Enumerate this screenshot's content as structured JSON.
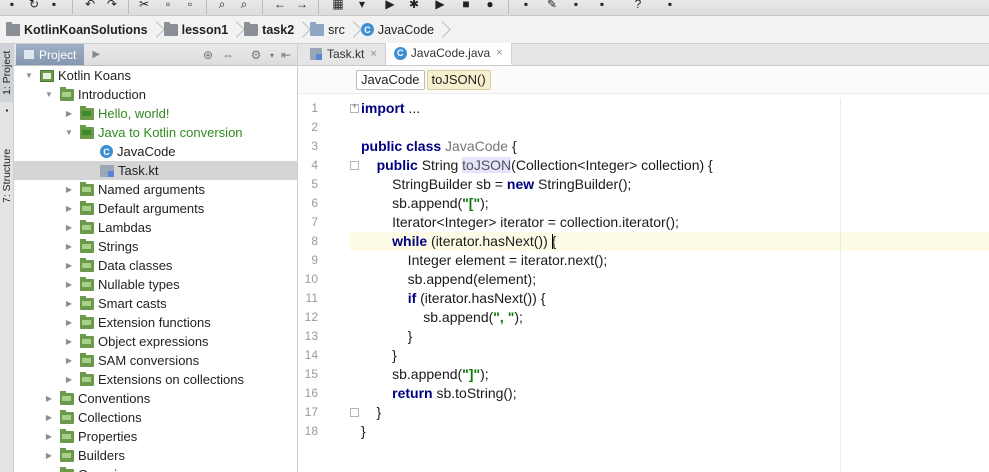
{
  "breadcrumb": {
    "items": [
      {
        "label": "KotlinKoanSolutions",
        "bold": true,
        "icon": "folder-icon"
      },
      {
        "label": "lesson1",
        "bold": true,
        "icon": "folder-icon"
      },
      {
        "label": "task2",
        "bold": true,
        "icon": "folder-icon"
      },
      {
        "label": "src",
        "bold": false,
        "icon": "source-folder-icon"
      },
      {
        "label": "JavaCode",
        "bold": false,
        "icon": "class-icon"
      }
    ]
  },
  "stripe": {
    "project_label": "1: Project",
    "structure_label": "7: Structure"
  },
  "project_panel": {
    "tab_label": "Project",
    "tree": [
      {
        "label": "Kotlin Koans",
        "depth": 0,
        "state": "open",
        "icon": "koans-icon",
        "green": false,
        "selected": false
      },
      {
        "label": "Introduction",
        "depth": 1,
        "state": "open",
        "icon": "task-icon",
        "green": false,
        "selected": false
      },
      {
        "label": "Hello, world!",
        "depth": 2,
        "state": "closed",
        "icon": "task-done-icon",
        "green": true,
        "selected": false
      },
      {
        "label": "Java to Kotlin conversion",
        "depth": 2,
        "state": "open",
        "icon": "task-done-icon",
        "green": true,
        "selected": false
      },
      {
        "label": "JavaCode",
        "depth": 3,
        "state": "none",
        "icon": "class-icon",
        "green": false,
        "selected": false
      },
      {
        "label": "Task.kt",
        "depth": 3,
        "state": "none",
        "icon": "kotlin-file-icon",
        "green": false,
        "selected": true
      },
      {
        "label": "Named arguments",
        "depth": 2,
        "state": "closed",
        "icon": "task-icon",
        "green": false,
        "selected": false
      },
      {
        "label": "Default arguments",
        "depth": 2,
        "state": "closed",
        "icon": "task-icon",
        "green": false,
        "selected": false
      },
      {
        "label": "Lambdas",
        "depth": 2,
        "state": "closed",
        "icon": "task-icon",
        "green": false,
        "selected": false
      },
      {
        "label": "Strings",
        "depth": 2,
        "state": "closed",
        "icon": "task-icon",
        "green": false,
        "selected": false
      },
      {
        "label": "Data classes",
        "depth": 2,
        "state": "closed",
        "icon": "task-icon",
        "green": false,
        "selected": false
      },
      {
        "label": "Nullable types",
        "depth": 2,
        "state": "closed",
        "icon": "task-icon",
        "green": false,
        "selected": false
      },
      {
        "label": "Smart casts",
        "depth": 2,
        "state": "closed",
        "icon": "task-icon",
        "green": false,
        "selected": false
      },
      {
        "label": "Extension functions",
        "depth": 2,
        "state": "closed",
        "icon": "task-icon",
        "green": false,
        "selected": false
      },
      {
        "label": "Object expressions",
        "depth": 2,
        "state": "closed",
        "icon": "task-icon",
        "green": false,
        "selected": false
      },
      {
        "label": "SAM conversions",
        "depth": 2,
        "state": "closed",
        "icon": "task-icon",
        "green": false,
        "selected": false
      },
      {
        "label": "Extensions on collections",
        "depth": 2,
        "state": "closed",
        "icon": "task-icon",
        "green": false,
        "selected": false
      },
      {
        "label": "Conventions",
        "depth": 1,
        "state": "closed",
        "icon": "task-icon",
        "green": false,
        "selected": false
      },
      {
        "label": "Collections",
        "depth": 1,
        "state": "closed",
        "icon": "task-icon",
        "green": false,
        "selected": false
      },
      {
        "label": "Properties",
        "depth": 1,
        "state": "closed",
        "icon": "task-icon",
        "green": false,
        "selected": false
      },
      {
        "label": "Builders",
        "depth": 1,
        "state": "closed",
        "icon": "task-icon",
        "green": false,
        "selected": false
      },
      {
        "label": "Generics",
        "depth": 1,
        "state": "closed",
        "icon": "task-icon",
        "green": false,
        "selected": false
      }
    ]
  },
  "editor": {
    "tabs": [
      {
        "label": "Task.kt",
        "active": false,
        "icon": "kotlin-file-icon"
      },
      {
        "label": "JavaCode.java",
        "active": true,
        "icon": "class-icon"
      }
    ],
    "structure_breadcrumb": [
      {
        "label": "JavaCode",
        "active": false
      },
      {
        "label": "toJSON()",
        "active": true
      }
    ],
    "caret_line": 8,
    "lines": [
      [
        [
          "kw",
          "import"
        ],
        [
          "plain",
          " ..."
        ]
      ],
      [],
      [
        [
          "kw",
          "public class "
        ],
        [
          "cls",
          "JavaCode"
        ],
        [
          "plain",
          " {"
        ]
      ],
      [
        [
          "plain",
          "    "
        ],
        [
          "kw",
          "public "
        ],
        [
          "plain",
          "String "
        ],
        [
          "hl",
          "toJSON"
        ],
        [
          "plain",
          "(Collection<Integer> collection) {"
        ]
      ],
      [
        [
          "plain",
          "        StringBuilder sb = "
        ],
        [
          "kw",
          "new "
        ],
        [
          "plain",
          "StringBuilder();"
        ]
      ],
      [
        [
          "plain",
          "        sb.append("
        ],
        [
          "str",
          "\"[\""
        ],
        [
          "plain",
          ");"
        ]
      ],
      [
        [
          "plain",
          "        Iterator<Integer> iterator = collection.iterator();"
        ]
      ],
      [
        [
          "plain",
          "        "
        ],
        [
          "kw",
          "while "
        ],
        [
          "plain",
          "(iterator.hasNext()) {"
        ]
      ],
      [
        [
          "plain",
          "            Integer element = iterator.next();"
        ]
      ],
      [
        [
          "plain",
          "            sb.append(element);"
        ]
      ],
      [
        [
          "plain",
          "            "
        ],
        [
          "kw",
          "if "
        ],
        [
          "plain",
          "(iterator.hasNext()) {"
        ]
      ],
      [
        [
          "plain",
          "                sb.append("
        ],
        [
          "str",
          "\", \""
        ],
        [
          "plain",
          ");"
        ]
      ],
      [
        [
          "plain",
          "            }"
        ]
      ],
      [
        [
          "plain",
          "        }"
        ]
      ],
      [
        [
          "plain",
          "        sb.append("
        ],
        [
          "str",
          "\"]\""
        ],
        [
          "plain",
          ");"
        ]
      ],
      [
        [
          "plain",
          "        "
        ],
        [
          "kw",
          "return "
        ],
        [
          "plain",
          "sb.toString();"
        ]
      ],
      [
        [
          "plain",
          "    }"
        ]
      ],
      [
        [
          "plain",
          "}"
        ]
      ]
    ]
  },
  "colors": {
    "keyword": "#000080",
    "string": "#0a7a0a",
    "caret_line_bg": "#fdfbe5",
    "selection_bg": "#d5d5d5",
    "project_tab_bg": "#8597b0",
    "completed_task_text": "#2f8a1f"
  }
}
